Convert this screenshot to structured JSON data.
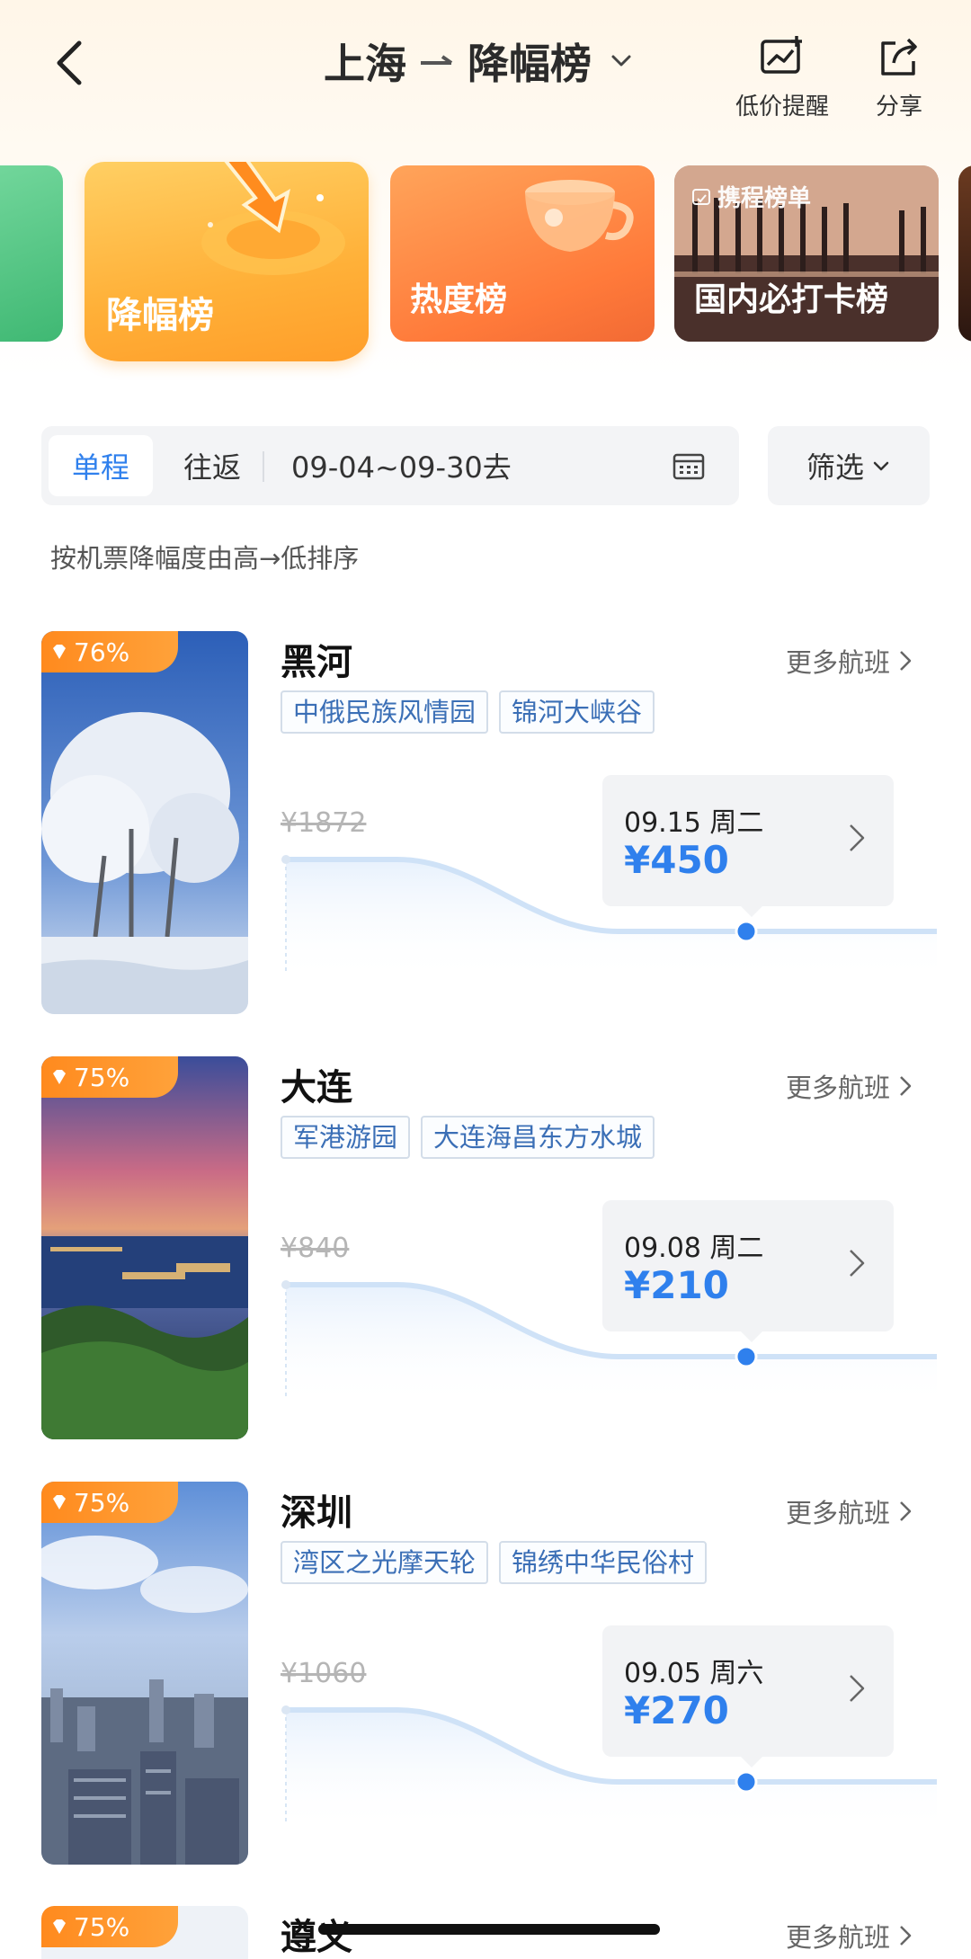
{
  "header": {
    "origin": "上海",
    "list_name": "降幅榜",
    "alert_label": "低价提醒",
    "share_label": "分享"
  },
  "categories": [
    {
      "label": "降幅榜"
    },
    {
      "label": "热度榜"
    },
    {
      "label": "国内必打卡榜",
      "tag": "携程榜单"
    }
  ],
  "filters": {
    "one_way": "单程",
    "round_trip": "往返",
    "date_range": "09-04~09-30去",
    "filter_label": "筛选",
    "sort_note": "按机票降幅度由高→低排序"
  },
  "colors": {
    "accent_blue": "#2f80ed",
    "badge_orange": "#ff8a1e"
  },
  "destinations": [
    {
      "drop": "76%",
      "city": "黑河",
      "more": "更多航班",
      "tags": [
        "中俄民族风情园",
        "锦河大峡谷"
      ],
      "original_price": "¥1872",
      "date": "09.15 周二",
      "price": "¥450",
      "image": "snowy-trees"
    },
    {
      "drop": "75%",
      "city": "大连",
      "more": "更多航班",
      "tags": [
        "军港游园",
        "大连海昌东方水城"
      ],
      "original_price": "¥840",
      "date": "09.08 周二",
      "price": "¥210",
      "image": "coastal-city-dusk"
    },
    {
      "drop": "75%",
      "city": "深圳",
      "more": "更多航班",
      "tags": [
        "湾区之光摩天轮",
        "锦绣中华民俗村"
      ],
      "original_price": "¥1060",
      "date": "09.05 周六",
      "price": "¥270",
      "image": "city-skyline"
    },
    {
      "drop": "75%",
      "city": "遵义",
      "more": "更多航班"
    }
  ]
}
